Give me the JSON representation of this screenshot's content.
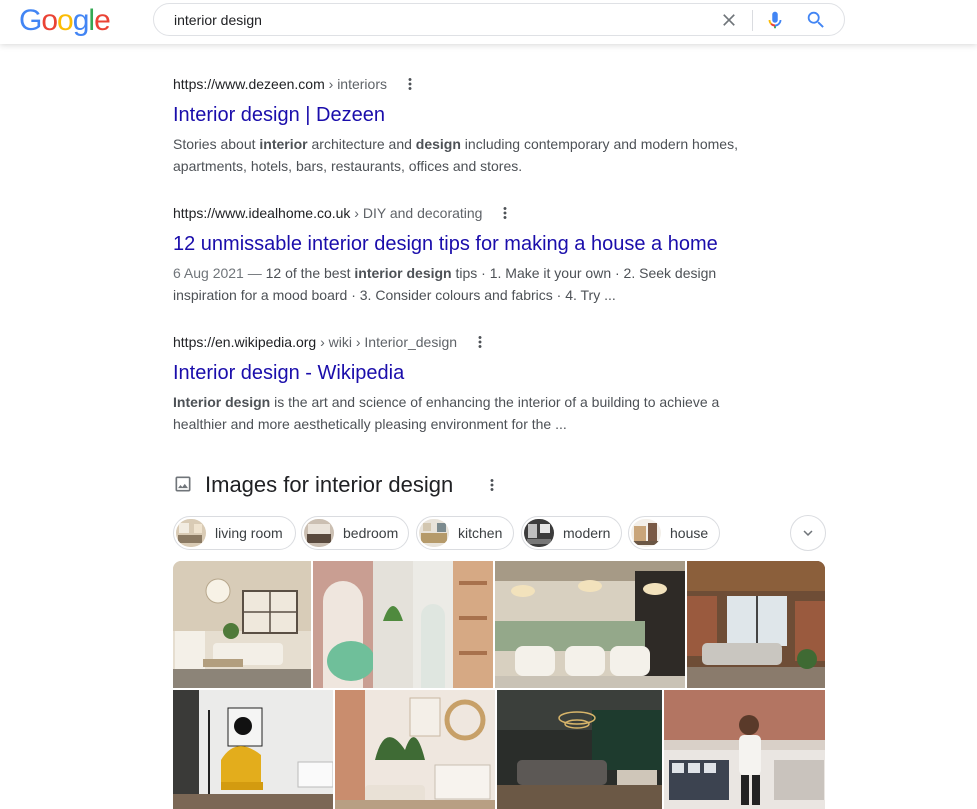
{
  "header": {
    "logo_letters": [
      {
        "ch": "G",
        "color": "#4285f4"
      },
      {
        "ch": "o",
        "color": "#ea4335"
      },
      {
        "ch": "o",
        "color": "#fbbc05"
      },
      {
        "ch": "g",
        "color": "#4285f4"
      },
      {
        "ch": "l",
        "color": "#34a853"
      },
      {
        "ch": "e",
        "color": "#ea4335"
      }
    ],
    "query": "interior design",
    "icons": {
      "clear": "close-icon",
      "voice": "microphone-icon",
      "search": "search-icon"
    }
  },
  "results": [
    {
      "cite_host": "https://www.dezeen.com",
      "cite_path": " › interiors",
      "title": "Interior design | Dezeen",
      "snippet": [
        {
          "t": "Stories about ",
          "b": false
        },
        {
          "t": "interior",
          "b": true
        },
        {
          "t": " architecture and ",
          "b": false
        },
        {
          "t": "design",
          "b": true
        },
        {
          "t": " including contemporary and modern homes, apartments, hotels, bars, restaurants, offices and stores.",
          "b": false
        }
      ]
    },
    {
      "cite_host": "https://www.idealhome.co.uk",
      "cite_path": " › DIY and decorating",
      "title": "12 unmissable interior design tips for making a house a home",
      "date": "6 Aug 2021 — ",
      "snippet": [
        {
          "t": "12 of the best ",
          "b": false
        },
        {
          "t": "interior design",
          "b": true
        },
        {
          "t": " tips · 1. Make it your own · 2. Seek design inspiration for a mood board · 3. Consider colours and fabrics · 4. Try ...",
          "b": false
        }
      ]
    },
    {
      "cite_host": "https://en.wikipedia.org",
      "cite_path": " › wiki › Interior_design",
      "title": "Interior design - Wikipedia",
      "snippet": [
        {
          "t": "Interior design",
          "b": true
        },
        {
          "t": " is the art and science of enhancing the interior of a building to achieve a healthier and more aesthetically pleasing environment for the ...",
          "b": false
        }
      ]
    }
  ],
  "images_section": {
    "title": "Images for interior design",
    "chips": [
      "living room",
      "bedroom",
      "kitchen",
      "modern",
      "house"
    ]
  },
  "colors": {
    "link": "#1a0dab",
    "snippet": "#4d5156",
    "cite_path": "#5f6368"
  }
}
